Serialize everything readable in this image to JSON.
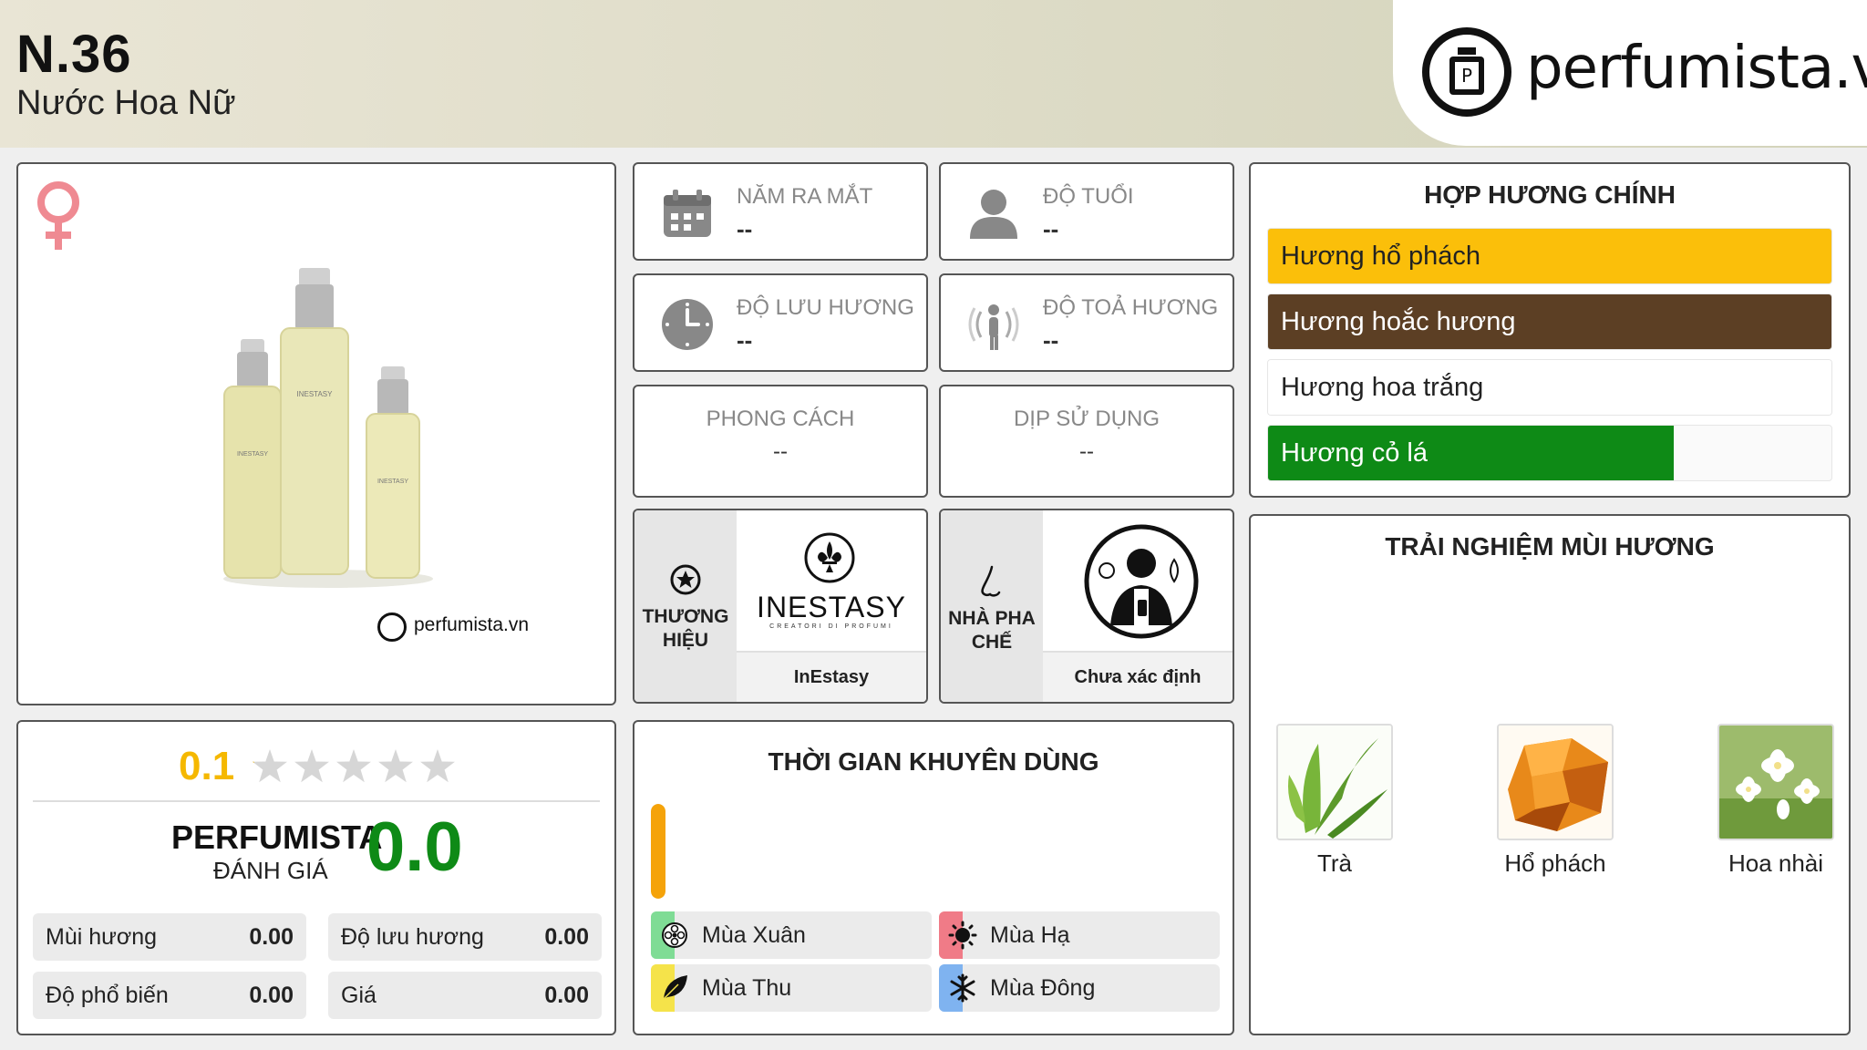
{
  "header": {
    "product_name": "N.36",
    "product_subtitle": "Nước Hoa Nữ",
    "site_name": "perfumista.vn"
  },
  "image_card": {
    "watermark": "perfumista.vn",
    "gender_icon": "female-symbol-icon",
    "bottle_brand": "INESTASY"
  },
  "stats": {
    "release_year": {
      "label": "NĂM RA MẮT",
      "value": "--",
      "icon": "calendar-icon"
    },
    "age": {
      "label": "ĐỘ TUỔI",
      "value": "--",
      "icon": "person-icon"
    },
    "longevity": {
      "label": "ĐỘ LƯU HƯƠNG",
      "value": "--",
      "icon": "clock-icon"
    },
    "sillage": {
      "label": "ĐỘ TOẢ HƯƠNG",
      "value": "--",
      "icon": "sillage-icon"
    },
    "style": {
      "label": "PHONG CÁCH",
      "value": "--"
    },
    "occasion": {
      "label": "DỊP SỬ DỤNG",
      "value": "--"
    }
  },
  "brand": {
    "label_line1": "THƯƠNG",
    "label_line2": "HIỆU",
    "logo_text": "INESTASY",
    "logo_tagline": "CREATORI DI PROFUMI",
    "name": "InEstasy"
  },
  "perfumer": {
    "label_line1": "NHÀ PHA",
    "label_line2": "CHẾ",
    "name": "Chưa xác định"
  },
  "accords": {
    "title": "HỢP HƯƠNG CHÍNH",
    "items": [
      {
        "label": "Hương hổ phách",
        "level": 1.0,
        "color": "#fbbf0a",
        "text_color": "#222222"
      },
      {
        "label": "Hương hoắc hương",
        "level": 1.0,
        "color": "#5c3f24",
        "text_color": "#ffffff"
      },
      {
        "label": "Hương hoa trắng",
        "level": 1.0,
        "color": "#ffffff",
        "text_color": "#222222"
      },
      {
        "label": "Hương cỏ lá",
        "level": 0.72,
        "color": "#0e8a16",
        "text_color": "#ffffff"
      }
    ]
  },
  "experience": {
    "title": "TRẢI NGHIỆM MÙI HƯƠNG",
    "notes": [
      {
        "label": "Trà",
        "icon": "tea-leaf-image"
      },
      {
        "label": "Hổ phách",
        "icon": "amber-stone-image"
      },
      {
        "label": "Hoa nhài",
        "icon": "jasmine-flower-image"
      }
    ]
  },
  "rating": {
    "user_score": "0.1",
    "stars_total": 5,
    "stars_filled_fraction": 0.02,
    "perfumista_label": "PERFUMISTA",
    "review_label": "ĐÁNH GIÁ",
    "perfumista_score": "0.0",
    "scores": [
      {
        "label": "Mùi hương",
        "value": "0.00"
      },
      {
        "label": "Độ lưu hương",
        "value": "0.00"
      },
      {
        "label": "Độ phổ biến",
        "value": "0.00"
      },
      {
        "label": "Giá",
        "value": "0.00"
      }
    ]
  },
  "recommend": {
    "title": "THỜI GIAN KHUYÊN DÙNG",
    "day_night_level": 1.0,
    "seasons": [
      {
        "label": "Mùa Xuân",
        "color": "#7fdc95",
        "icon": "spring-flower-icon"
      },
      {
        "label": "Mùa Hạ",
        "color": "#f07b87",
        "icon": "sun-icon"
      },
      {
        "label": "Mùa Thu",
        "color": "#f5e34a",
        "icon": "autumn-leaf-icon"
      },
      {
        "label": "Mùa Đông",
        "color": "#7fb3f0",
        "icon": "snowflake-icon"
      }
    ]
  },
  "colors": {
    "rating_yellow": "#f5b800",
    "score_green": "#0e8a16",
    "star_grey": "#d6d6d6",
    "time_bar_orange": "#f5a30a"
  }
}
